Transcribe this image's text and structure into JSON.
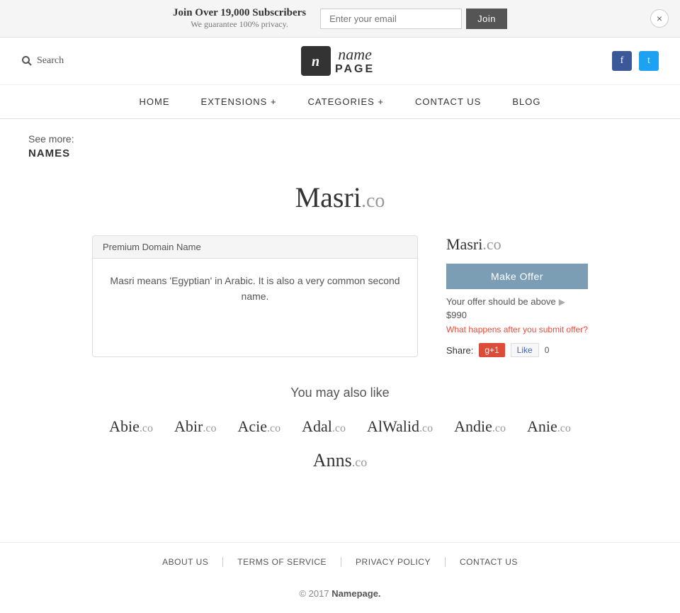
{
  "topBanner": {
    "mainText": "Join Over 19,000 Subscribers",
    "subText": "We guarantee 100% privacy.",
    "emailPlaceholder": "Enter your email",
    "joinLabel": "Join",
    "closeLabel": "×"
  },
  "header": {
    "searchLabel": "Search",
    "logoIconText": "n",
    "logoName": "name",
    "logoPage": "PAGE",
    "facebookIcon": "f",
    "twitterIcon": "t"
  },
  "nav": {
    "items": [
      {
        "label": "HOME"
      },
      {
        "label": "EXTENSIONS +"
      },
      {
        "label": "CATEGORIES +"
      },
      {
        "label": "CONTACT US"
      },
      {
        "label": "BLOG"
      }
    ]
  },
  "seeMore": {
    "label": "See more:",
    "link": "NAMES"
  },
  "domain": {
    "name": "Masri",
    "tld": ".co",
    "fullName": "Masri.co",
    "cardHeader": "Premium Domain Name",
    "description": "Masri means 'Egyptian' in Arabic. It is also a very common second name.",
    "offerButtonLabel": "Make Offer",
    "offerHintText": "Your offer should be above",
    "offerPrice": "$990",
    "whatHappensText": "What happens after you submit offer?",
    "shareLabel": "Share:",
    "gPlusLabel": "g+1",
    "fbLikeLabel": "Like",
    "fbLikeCount": "0"
  },
  "alsoLike": {
    "title": "You may also like",
    "domains": [
      {
        "name": "Abie",
        "tld": ".co"
      },
      {
        "name": "Abir",
        "tld": ".co"
      },
      {
        "name": "Acie",
        "tld": ".co"
      },
      {
        "name": "Adal",
        "tld": ".co"
      },
      {
        "name": "AlWalid",
        "tld": ".co"
      },
      {
        "name": "Andie",
        "tld": ".co"
      },
      {
        "name": "Anie",
        "tld": ".co"
      }
    ],
    "bottomDomain": {
      "name": "Anns",
      "tld": ".co"
    }
  },
  "footer": {
    "links": [
      {
        "label": "ABOUT US"
      },
      {
        "label": "TERMS OF SERVICE"
      },
      {
        "label": "PRIVACY POLICY"
      },
      {
        "label": "CONTACT US"
      }
    ],
    "copyright": "© 2017",
    "copyrightBrand": "Namepage."
  }
}
